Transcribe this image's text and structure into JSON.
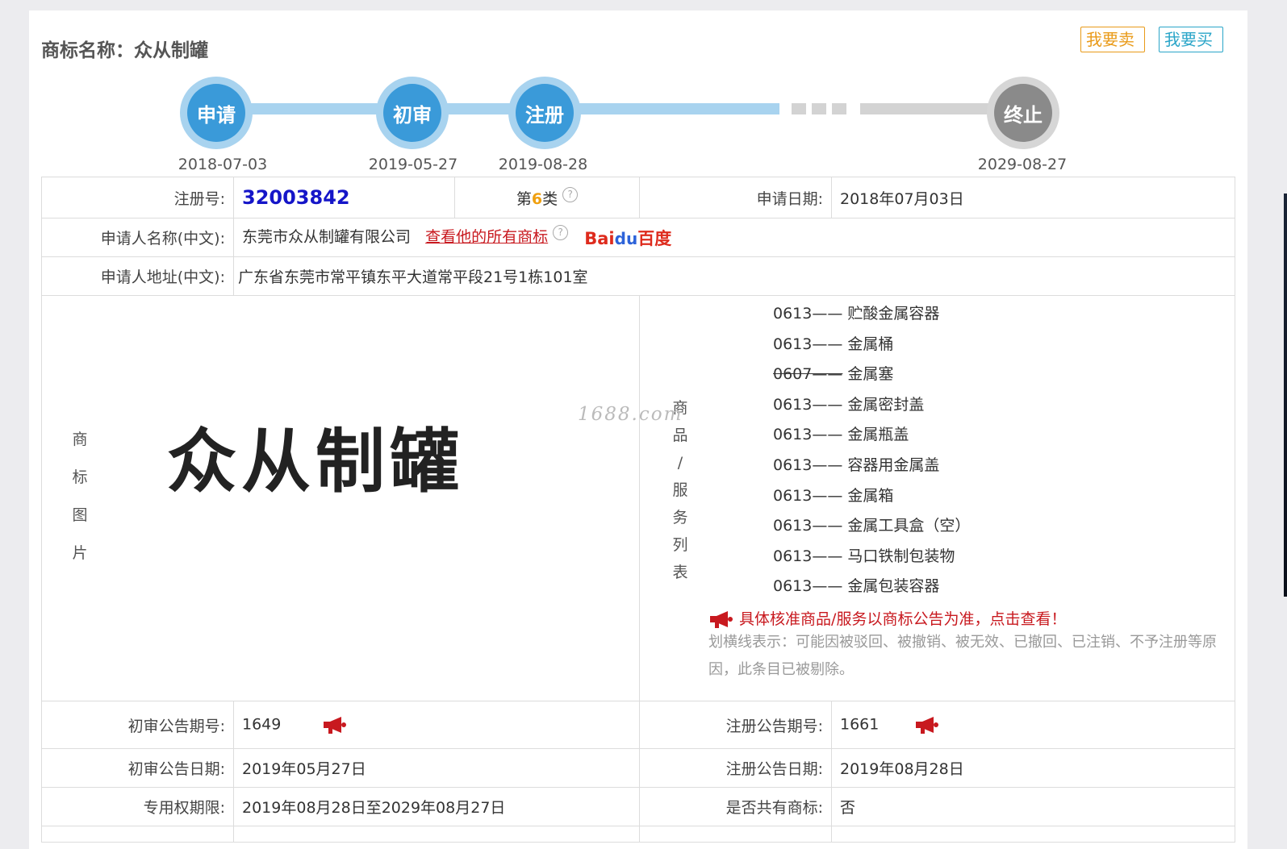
{
  "header": {
    "title": "商标名称：众从制罐",
    "sell_label": "我要卖",
    "buy_label": "我要买"
  },
  "timeline": [
    {
      "label": "申请",
      "date": "2018-07-03",
      "state": "active"
    },
    {
      "label": "初审",
      "date": "2019-05-27",
      "state": "active"
    },
    {
      "label": "注册",
      "date": "2019-08-28",
      "state": "active"
    },
    {
      "label": "终止",
      "date": "2029-08-27",
      "state": "inactive"
    }
  ],
  "info": {
    "reg_no_label": "注册号:",
    "reg_no": "32003842",
    "class_prefix": "第",
    "class_num": "6",
    "class_suffix": "类",
    "apply_date_label": "申请日期:",
    "apply_date": "2018年07月03日",
    "applicant_name_label": "申请人名称(中文):",
    "applicant_name": "东莞市众从制罐有限公司",
    "all_marks_link": "查看他的所有商标",
    "baidu_text_a": "Bai",
    "baidu_paw": "du",
    "baidu_text_b": "百度",
    "applicant_addr_label": "申请人地址(中文):",
    "applicant_addr": "广东省东莞市常平镇东平大道常平段21号1栋101室",
    "mark_image_label": [
      "商",
      "标",
      "图",
      "片"
    ],
    "mark_text": "众从制罐",
    "watermark": "1688.com",
    "goods_label": [
      "商",
      "品",
      "/",
      "服",
      "务",
      "列",
      "表"
    ],
    "goods": [
      {
        "code": "0613——",
        "name": "贮酸金属容器",
        "struck": false
      },
      {
        "code": "0613——",
        "name": "金属桶",
        "struck": false
      },
      {
        "code": "0607——",
        "name": "金属塞",
        "struck": true
      },
      {
        "code": "0613——",
        "name": "金属密封盖",
        "struck": false
      },
      {
        "code": "0613——",
        "name": "金属瓶盖",
        "struck": false
      },
      {
        "code": "0613——",
        "name": "容器用金属盖",
        "struck": false
      },
      {
        "code": "0613——",
        "name": "金属箱",
        "struck": false
      },
      {
        "code": "0613——",
        "name": "金属工具盒（空）",
        "struck": false
      },
      {
        "code": "0613——",
        "name": "马口铁制包装物",
        "struck": false
      },
      {
        "code": "0613——",
        "name": "金属包装容器",
        "struck": false
      }
    ],
    "goods_notice": "具体核准商品/服务以商标公告为准，点击查看！",
    "strike_note": "划横线表示：可能因被驳回、被撤销、被无效、已撤回、已注销、不予注册等原因，此条目已被剔除。",
    "prelim_no_label": "初审公告期号:",
    "prelim_no": "1649",
    "reg_pub_no_label": "注册公告期号:",
    "reg_pub_no": "1661",
    "prelim_date_label": "初审公告日期:",
    "prelim_date": "2019年05月27日",
    "reg_pub_date_label": "注册公告日期:",
    "reg_pub_date": "2019年08月28日",
    "term_label": "专用权期限:",
    "term": "2019年08月28日至2029年08月27日",
    "shared_label": "是否共有商标:",
    "shared": "否"
  }
}
